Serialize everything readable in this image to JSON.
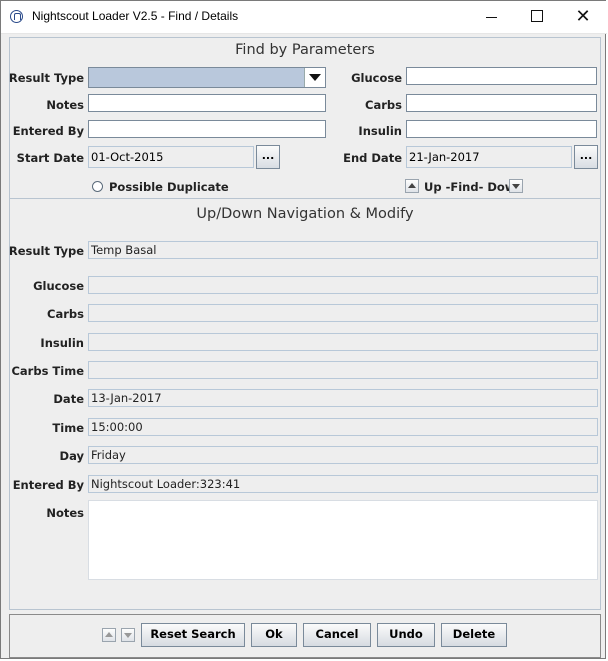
{
  "window": {
    "title": "Nightscout Loader V2.5 - Find / Details"
  },
  "find": {
    "title": "Find by Parameters",
    "result_type_label": "Result Type",
    "result_type_value": "",
    "notes_label": "Notes",
    "notes_value": "",
    "entered_by_label": "Entered By",
    "entered_by_value": "",
    "start_date_label": "Start Date",
    "start_date_value": "01-Oct-2015",
    "end_date_label": "End Date",
    "end_date_value": "21-Jan-2017",
    "glucose_label": "Glucose",
    "glucose_value": "",
    "carbs_label": "Carbs",
    "carbs_value": "",
    "insulin_label": "Insulin",
    "insulin_value": "",
    "possible_duplicate_label": "Possible Duplicate",
    "find_nav_label": "Up -Find- Down",
    "dots_label": "..."
  },
  "nav": {
    "title": "Up/Down Navigation & Modify",
    "result_type_label": "Result Type",
    "result_type_value": "Temp Basal",
    "glucose_label": "Glucose",
    "glucose_value": "",
    "carbs_label": "Carbs",
    "carbs_value": "",
    "insulin_label": "Insulin",
    "insulin_value": "",
    "carbs_time_label": "Carbs Time",
    "carbs_time_value": "",
    "date_label": "Date",
    "date_value": "13-Jan-2017",
    "time_label": "Time",
    "time_value": "15:00:00",
    "day_label": "Day",
    "day_value": "Friday",
    "entered_by_label": "Entered By",
    "entered_by_value": "Nightscout Loader:323:41",
    "notes_label": "Notes",
    "notes_value": ""
  },
  "buttons": {
    "reset_search": "Reset Search",
    "ok": "Ok",
    "cancel": "Cancel",
    "undo": "Undo",
    "delete": "Delete"
  }
}
